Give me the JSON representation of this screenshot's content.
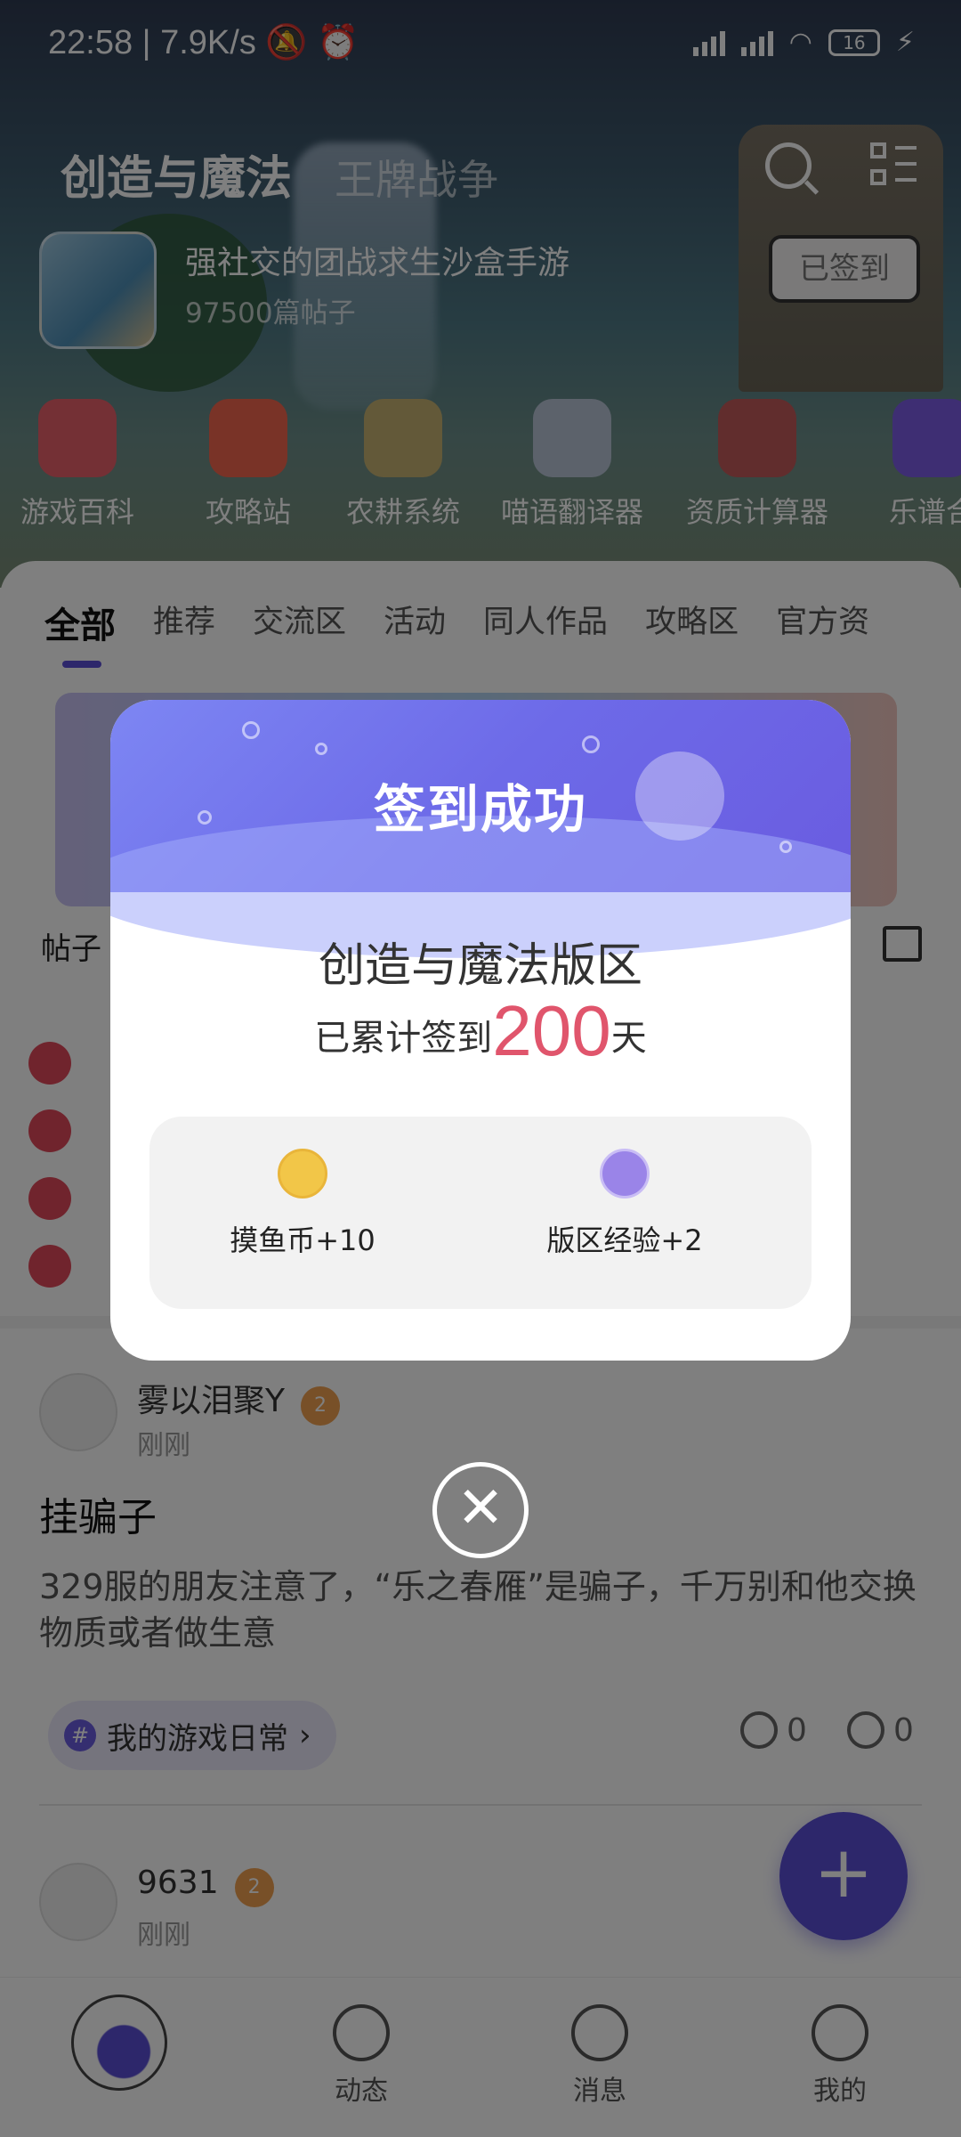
{
  "status_bar": {
    "time": "22:58",
    "speed": "7.9K/s",
    "battery": "16"
  },
  "header": {
    "title_active": "创造与魔法",
    "title_inactive": "王牌战争"
  },
  "forum": {
    "description": "强社交的团战求生沙盒手游",
    "post_count": "97500篇帖子",
    "signed_label": "已签到"
  },
  "shortcuts": [
    {
      "label": "游戏百科",
      "color": "#e8606b"
    },
    {
      "label": "攻略站",
      "color": "#f2664f"
    },
    {
      "label": "农耕系统",
      "color": "#c7b373"
    },
    {
      "label": "喵语翻译器",
      "color": "#b8c4d6"
    },
    {
      "label": "资质计算器",
      "color": "#c25a5a"
    },
    {
      "label": "乐谱合",
      "color": "#7c5ce6"
    }
  ],
  "tabs": [
    "全部",
    "推荐",
    "交流区",
    "活动",
    "同人作品",
    "攻略区",
    "官方资"
  ],
  "section": {
    "posts_label": "帖子"
  },
  "posts": [
    {
      "user": "雾以泪聚Y",
      "level": "2",
      "time": "刚刚",
      "title": "挂骗子",
      "body": "329服的朋友注意了，“乐之春雁”是骗子，千万别和他交换物质或者做生意",
      "tag": "我的游戏日常",
      "comments": "0",
      "likes": "0"
    },
    {
      "user": "9631",
      "level": "2",
      "time": "刚刚"
    }
  ],
  "bottom_nav": {
    "dynamic": "动态",
    "messages": "消息",
    "mine": "我的"
  },
  "dialog": {
    "title": "签到成功",
    "forum": "创造与魔法版区",
    "streak_prefix": "已累计签到",
    "streak_days": "200",
    "streak_suffix": "天",
    "rewards": [
      {
        "label": "摸鱼币+10",
        "icon": "fish-coin-icon",
        "color": "#f2c648"
      },
      {
        "label": "版区经验+2",
        "icon": "star-badge-icon",
        "color": "#9a84e8"
      }
    ]
  },
  "colors": {
    "accent": "#5a4fd6",
    "highlight": "#e0556c"
  }
}
